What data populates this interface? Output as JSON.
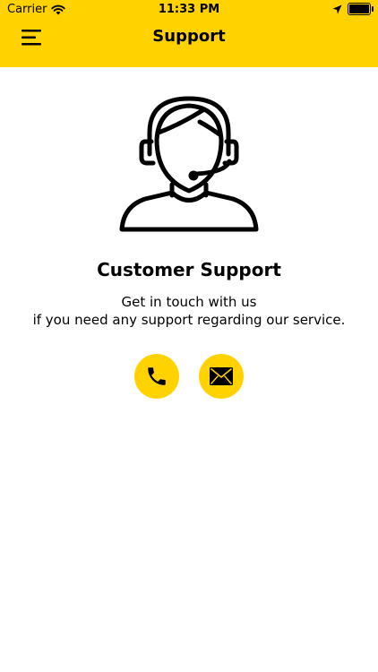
{
  "status_bar": {
    "carrier": "Carrier",
    "time": "11:33 PM"
  },
  "header": {
    "title": "Support",
    "menu_icon": "hamburger-menu-icon"
  },
  "main": {
    "illustration_icon": "customer-support-agent-icon",
    "heading": "Customer Support",
    "description_line1": "Get in touch with us",
    "description_line2": "if you need any support regarding our service.",
    "actions": [
      {
        "icon": "phone-icon"
      },
      {
        "icon": "mail-icon"
      }
    ]
  },
  "colors": {
    "accent": "#FFD200",
    "background": "#FFFFFF",
    "text": "#000000"
  }
}
